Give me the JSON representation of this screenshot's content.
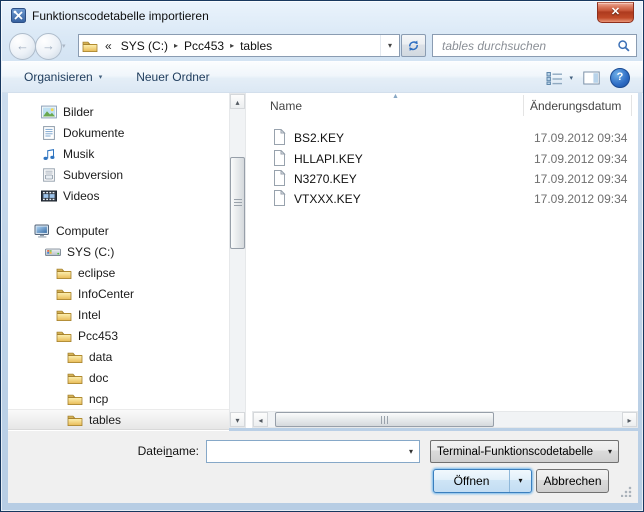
{
  "window": {
    "title": "Funktionscodetabelle importieren",
    "close_glyph": "✕"
  },
  "glyphs": {
    "dropdown": "▾",
    "up": "▴",
    "down": "▾",
    "left": "◂",
    "right": "▸",
    "back": "←",
    "forward": "→",
    "sort_asc": "▲",
    "crumb_separator": "▸",
    "help": "?"
  },
  "nav": {
    "address": {
      "overflow": "«",
      "crumbs": [
        "SYS (C:)",
        "Pcc453",
        "tables"
      ]
    },
    "search": {
      "placeholder": "tables durchsuchen"
    }
  },
  "toolbar": {
    "organize": "Organisieren",
    "new_folder": "Neuer Ordner"
  },
  "sidebar": {
    "libraries": [
      {
        "label": "Bilder",
        "icon": "pictures-icon"
      },
      {
        "label": "Dokumente",
        "icon": "documents-icon"
      },
      {
        "label": "Musik",
        "icon": "music-icon"
      },
      {
        "label": "Subversion",
        "icon": "saved-search-icon"
      },
      {
        "label": "Videos",
        "icon": "videos-icon"
      }
    ],
    "tree": [
      {
        "label": "Computer",
        "icon": "computer-icon",
        "level": 0
      },
      {
        "label": "SYS (C:)",
        "icon": "drive-icon",
        "level": 1
      },
      {
        "label": "eclipse",
        "icon": "folder-icon",
        "level": 2
      },
      {
        "label": "InfoCenter",
        "icon": "folder-icon",
        "level": 2
      },
      {
        "label": "Intel",
        "icon": "folder-icon",
        "level": 2
      },
      {
        "label": "Pcc453",
        "icon": "folder-icon",
        "level": 2
      },
      {
        "label": "data",
        "icon": "folder-icon",
        "level": 3
      },
      {
        "label": "doc",
        "icon": "folder-icon",
        "level": 3
      },
      {
        "label": "ncp",
        "icon": "folder-icon",
        "level": 3
      },
      {
        "label": "tables",
        "icon": "folder-icon",
        "level": 3,
        "selected": true
      }
    ]
  },
  "file_list": {
    "columns": {
      "name": "Name",
      "modified": "Änderungsdatum"
    },
    "files": [
      {
        "name": "BS2.KEY",
        "modified": "17.09.2012 09:34"
      },
      {
        "name": "HLLAPI.KEY",
        "modified": "17.09.2012 09:34"
      },
      {
        "name": "N3270.KEY",
        "modified": "17.09.2012 09:34"
      },
      {
        "name": "VTXXX.KEY",
        "modified": "17.09.2012 09:34"
      }
    ]
  },
  "footer": {
    "filename_label_pre": "Datei",
    "filename_label_key": "n",
    "filename_label_post": "ame:",
    "filename_value": "",
    "filetype_value": "Terminal-Funktionscodetabelle",
    "open": "Öffnen",
    "cancel": "Abbrechen"
  },
  "colors": {
    "close_button": "#b03a1e",
    "frame": "#bed3e8",
    "selection": "#e7e7e7"
  }
}
